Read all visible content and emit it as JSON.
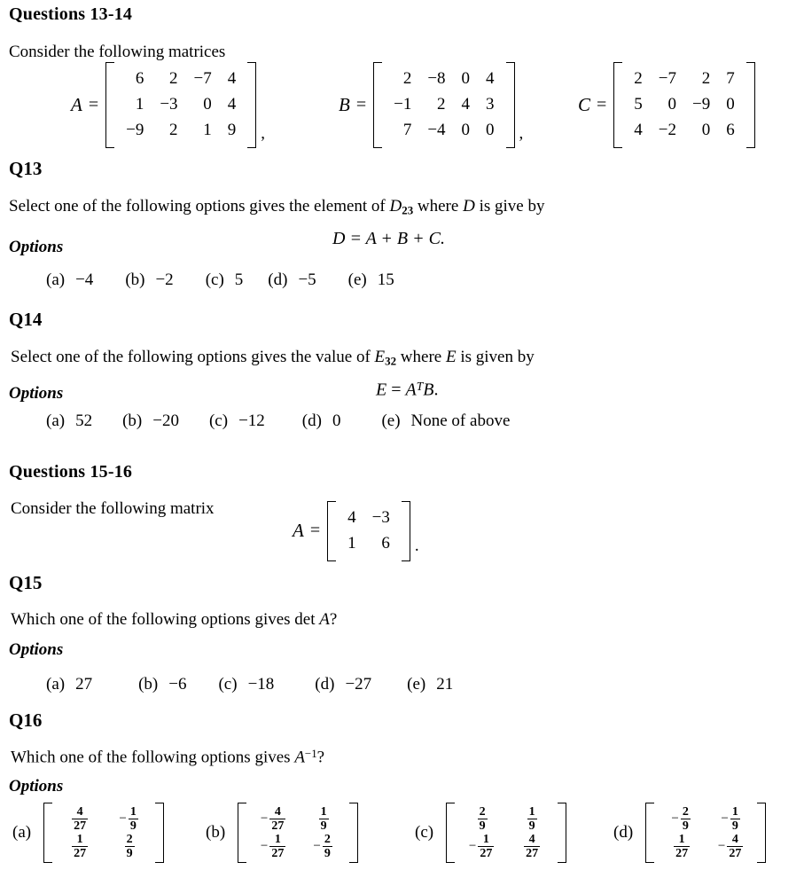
{
  "sections": {
    "q13_14_heading": "Questions 13-14",
    "q15_16_heading": "Questions 15-16",
    "consider_matrices": "Consider the following matrices",
    "consider_matrix": "Consider the following matrix"
  },
  "matrices": {
    "A": {
      "name": "A",
      "rows": [
        [
          "6",
          "2",
          "−7",
          "4"
        ],
        [
          "1",
          "−3",
          "0",
          "4"
        ],
        [
          "−9",
          "2",
          "1",
          "9"
        ]
      ],
      "trailing": ","
    },
    "B": {
      "name": "B",
      "rows": [
        [
          "2",
          "−8",
          "0",
          "4"
        ],
        [
          "−1",
          "2",
          "4",
          "3"
        ],
        [
          "7",
          "−4",
          "0",
          "0"
        ]
      ],
      "trailing": ","
    },
    "C": {
      "name": "C",
      "rows": [
        [
          "2",
          "−7",
          "2",
          "7"
        ],
        [
          "5",
          "0",
          "−9",
          "0"
        ],
        [
          "4",
          "−2",
          "0",
          "6"
        ]
      ],
      "trailing": ""
    },
    "A2x2": {
      "name": "A",
      "rows": [
        [
          "4",
          "−3"
        ],
        [
          "1",
          "6"
        ]
      ],
      "trailing": "."
    }
  },
  "q13": {
    "heading": "Q13",
    "prompt_pre": "Select one of the following options gives the element of ",
    "symbol": "D",
    "subscript": "23",
    "prompt_post": " where ",
    "symbol2": "D",
    "prompt_end": " is give by",
    "formula": "D = A + B + C.",
    "options_label": "Options",
    "options": [
      {
        "tag": "(a)",
        "value": "−4"
      },
      {
        "tag": "(b)",
        "value": "−2"
      },
      {
        "tag": "(c)",
        "value": "5"
      },
      {
        "tag": "(d)",
        "value": "−5"
      },
      {
        "tag": "(e)",
        "value": "15"
      }
    ]
  },
  "q14": {
    "heading": "Q14",
    "prompt_pre": "Select one of the following options gives the value of ",
    "symbol": "E",
    "subscript": "32",
    "prompt_post": " where ",
    "symbol2": "E",
    "prompt_end": " is given by",
    "formula_lhs": "E",
    "formula_eq": " = ",
    "formula_A": "A",
    "formula_T": "T",
    "formula_B": "B",
    "formula_period": ".",
    "options_label": "Options",
    "options": [
      {
        "tag": "(a)",
        "value": "52"
      },
      {
        "tag": "(b)",
        "value": "−20"
      },
      {
        "tag": "(c)",
        "value": "−12"
      },
      {
        "tag": "(d)",
        "value": "0"
      },
      {
        "tag": "(e)",
        "value": "None of above"
      }
    ]
  },
  "q15": {
    "heading": "Q15",
    "prompt_pre": "Which one of the following options gives det ",
    "symbol": "A",
    "prompt_end": "?",
    "options_label": "Options",
    "options": [
      {
        "tag": "(a)",
        "value": "27"
      },
      {
        "tag": "(b)",
        "value": "−6"
      },
      {
        "tag": "(c)",
        "value": "−18"
      },
      {
        "tag": "(d)",
        "value": "−27"
      },
      {
        "tag": "(e)",
        "value": "21"
      }
    ]
  },
  "q16": {
    "heading": "Q16",
    "prompt_pre": "Which one of the following options gives ",
    "symbol": "A",
    "superscript": "−1",
    "prompt_end": "?",
    "options_label": "Options",
    "options": [
      {
        "tag": "(a)",
        "cells": [
          {
            "sign": "",
            "num": "4",
            "den": "27"
          },
          {
            "sign": "−",
            "num": "1",
            "den": "9"
          },
          {
            "sign": "",
            "num": "1",
            "den": "27"
          },
          {
            "sign": "",
            "num": "2",
            "den": "9"
          }
        ]
      },
      {
        "tag": "(b)",
        "cells": [
          {
            "sign": "−",
            "num": "4",
            "den": "27"
          },
          {
            "sign": "",
            "num": "1",
            "den": "9"
          },
          {
            "sign": "−",
            "num": "1",
            "den": "27"
          },
          {
            "sign": "−",
            "num": "2",
            "den": "9"
          }
        ]
      },
      {
        "tag": "(c)",
        "cells": [
          {
            "sign": "",
            "num": "2",
            "den": "9"
          },
          {
            "sign": "",
            "num": "1",
            "den": "9"
          },
          {
            "sign": "−",
            "num": "1",
            "den": "27"
          },
          {
            "sign": "",
            "num": "4",
            "den": "27"
          }
        ]
      },
      {
        "tag": "(d)",
        "cells": [
          {
            "sign": "−",
            "num": "2",
            "den": "9"
          },
          {
            "sign": "−",
            "num": "1",
            "den": "9"
          },
          {
            "sign": "",
            "num": "1",
            "den": "27"
          },
          {
            "sign": "−",
            "num": "4",
            "den": "27"
          }
        ]
      }
    ]
  }
}
